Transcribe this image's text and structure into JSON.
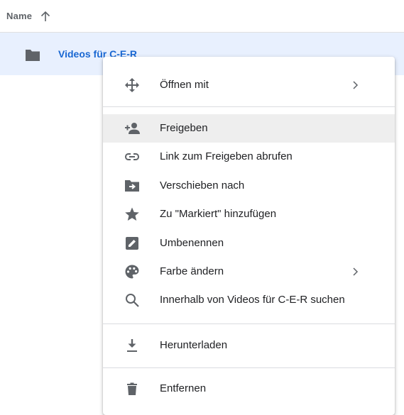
{
  "list_header": {
    "name_column": "Name",
    "sort_icon": "arrow-up-icon"
  },
  "file": {
    "name": "Videos für C-E-R",
    "icon": "folder-icon",
    "selected": true
  },
  "context_menu": {
    "items": [
      {
        "label": "Öffnen mit",
        "icon": "move-arrows-icon",
        "submenu": true
      },
      {
        "label": "Freigeben",
        "icon": "add-person-icon",
        "highlighted": true
      },
      {
        "label": "Link zum Freigeben abrufen",
        "icon": "link-icon"
      },
      {
        "label": "Verschieben nach",
        "icon": "move-folder-icon"
      },
      {
        "label": "Zu \"Markiert\" hinzufügen",
        "icon": "star-icon"
      },
      {
        "label": "Umbenennen",
        "icon": "rename-icon"
      },
      {
        "label": "Farbe ändern",
        "icon": "palette-icon",
        "submenu": true
      },
      {
        "label": "Innerhalb von Videos für C-E-R suchen",
        "icon": "search-icon"
      },
      {
        "label": "Herunterladen",
        "icon": "download-icon"
      },
      {
        "label": "Entfernen",
        "icon": "trash-icon"
      }
    ]
  },
  "colors": {
    "selected_row_bg": "#e8f0fe",
    "file_name": "#1967d2",
    "icon_gray": "#5f6368",
    "hover_bg": "#eeeeee"
  }
}
